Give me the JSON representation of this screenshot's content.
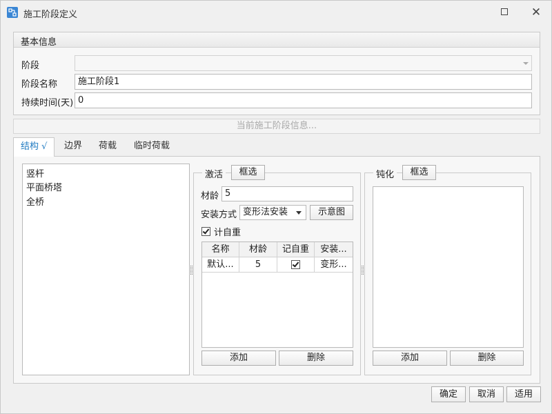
{
  "window": {
    "title": "施工阶段定义"
  },
  "basic_info": {
    "header": "基本信息",
    "stage_label": "阶段",
    "stage_value": "",
    "stage_name_label": "阶段名称",
    "stage_name_value": "施工阶段1",
    "duration_label": "持续时间(天)",
    "duration_value": "0"
  },
  "info_bar": "当前施工阶段信息...",
  "tabs": [
    {
      "label": "结构 √",
      "active": true
    },
    {
      "label": "边界",
      "active": false
    },
    {
      "label": "荷载",
      "active": false
    },
    {
      "label": "临时荷载",
      "active": false
    }
  ],
  "structure_list": [
    "竖杆",
    "平面桥塔",
    "全桥"
  ],
  "activate": {
    "legend": "激活",
    "box_select": "框选",
    "age_label": "材龄",
    "age_value": "5",
    "install_label": "安装方式",
    "install_value": "变形法安装",
    "diagram_button": "示意图",
    "self_weight_label": "计自重",
    "self_weight_checked": true,
    "columns": [
      "名称",
      "材龄",
      "记自重",
      "安装..."
    ],
    "rows": [
      {
        "name": "默认...",
        "age": "5",
        "self_weight": true,
        "install": "变形..."
      }
    ],
    "add_button": "添加",
    "delete_button": "删除"
  },
  "passivate": {
    "legend": "钝化",
    "box_select": "框选",
    "add_button": "添加",
    "delete_button": "删除"
  },
  "footer": {
    "ok": "确定",
    "cancel": "取消",
    "apply": "适用"
  },
  "colors": {
    "accent": "#1f7ac1",
    "app_icon": "#3a86d4"
  }
}
